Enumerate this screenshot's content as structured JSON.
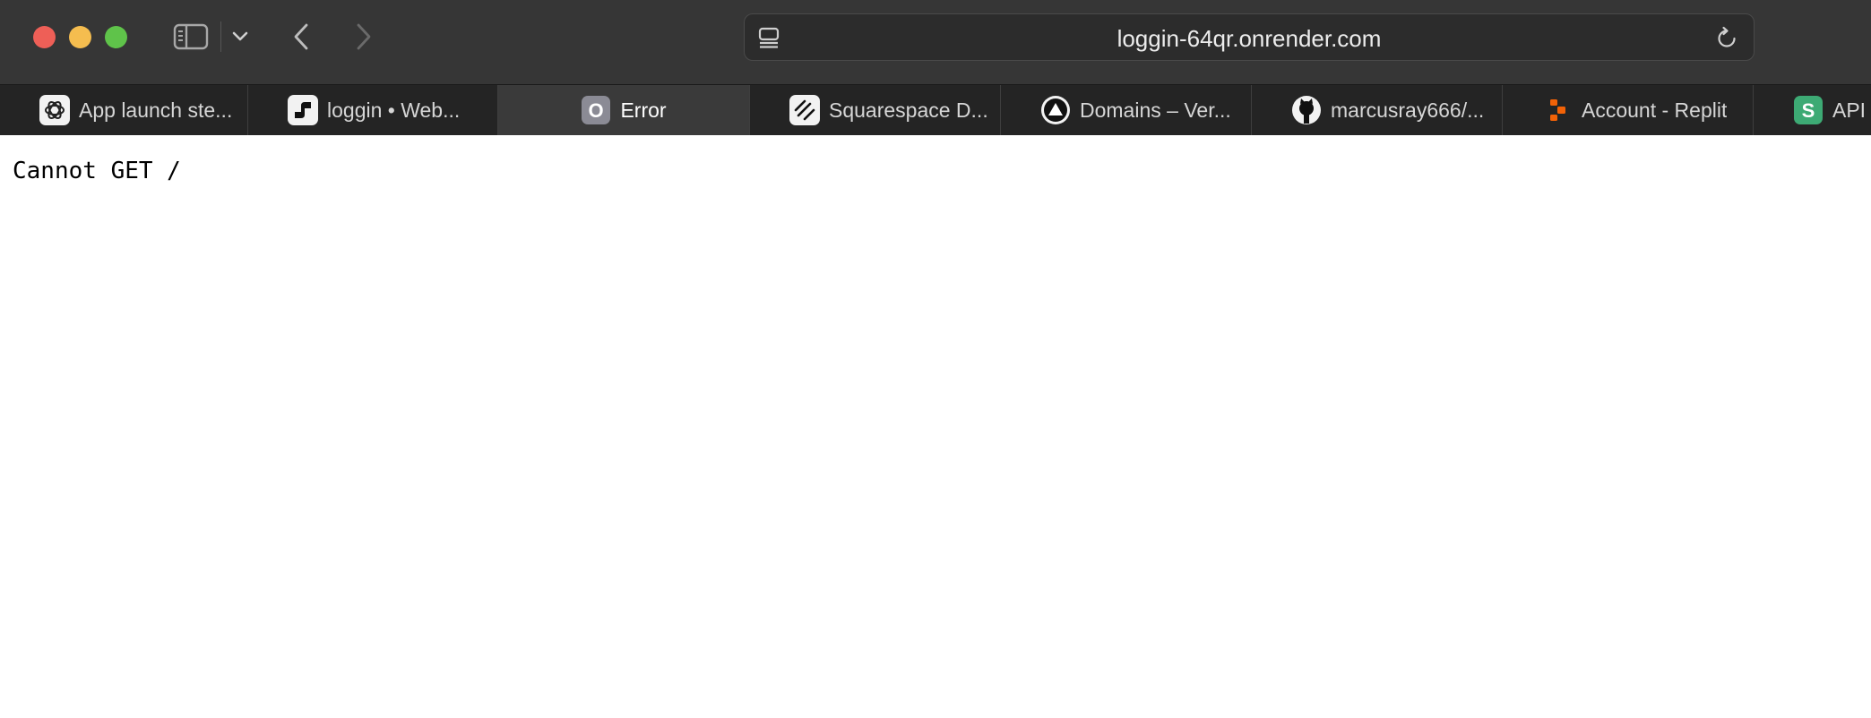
{
  "window": {
    "url": "loggin-64qr.onrender.com",
    "colors": {
      "close": "#ee5f57",
      "minimize": "#f5bd4f",
      "zoom": "#5fc34a",
      "toolbar": "#363636",
      "tabbar": "#242424",
      "active_tab": "#3a3a3a"
    }
  },
  "toolbar": {
    "icons": [
      "sidebar-icon",
      "chevron-down-icon",
      "back-arrow-icon",
      "forward-arrow-icon",
      "page-menu-icon",
      "reload-icon"
    ]
  },
  "tabs": [
    {
      "label": "App launch ste...",
      "icon": "openai-icon"
    },
    {
      "label": "loggin  •  Web...",
      "icon": "render-icon"
    },
    {
      "label": "Error",
      "icon": "letter-o-icon",
      "active": true
    },
    {
      "label": "Squarespace D...",
      "icon": "squarespace-icon"
    },
    {
      "label": "Domains – Ver...",
      "icon": "vercel-icon"
    },
    {
      "label": "marcusray666/...",
      "icon": "github-icon"
    },
    {
      "label": "Account - Replit",
      "icon": "replit-icon"
    },
    {
      "label": "API",
      "icon": "letter-s-icon"
    }
  ],
  "page": {
    "message": "Cannot GET /"
  }
}
